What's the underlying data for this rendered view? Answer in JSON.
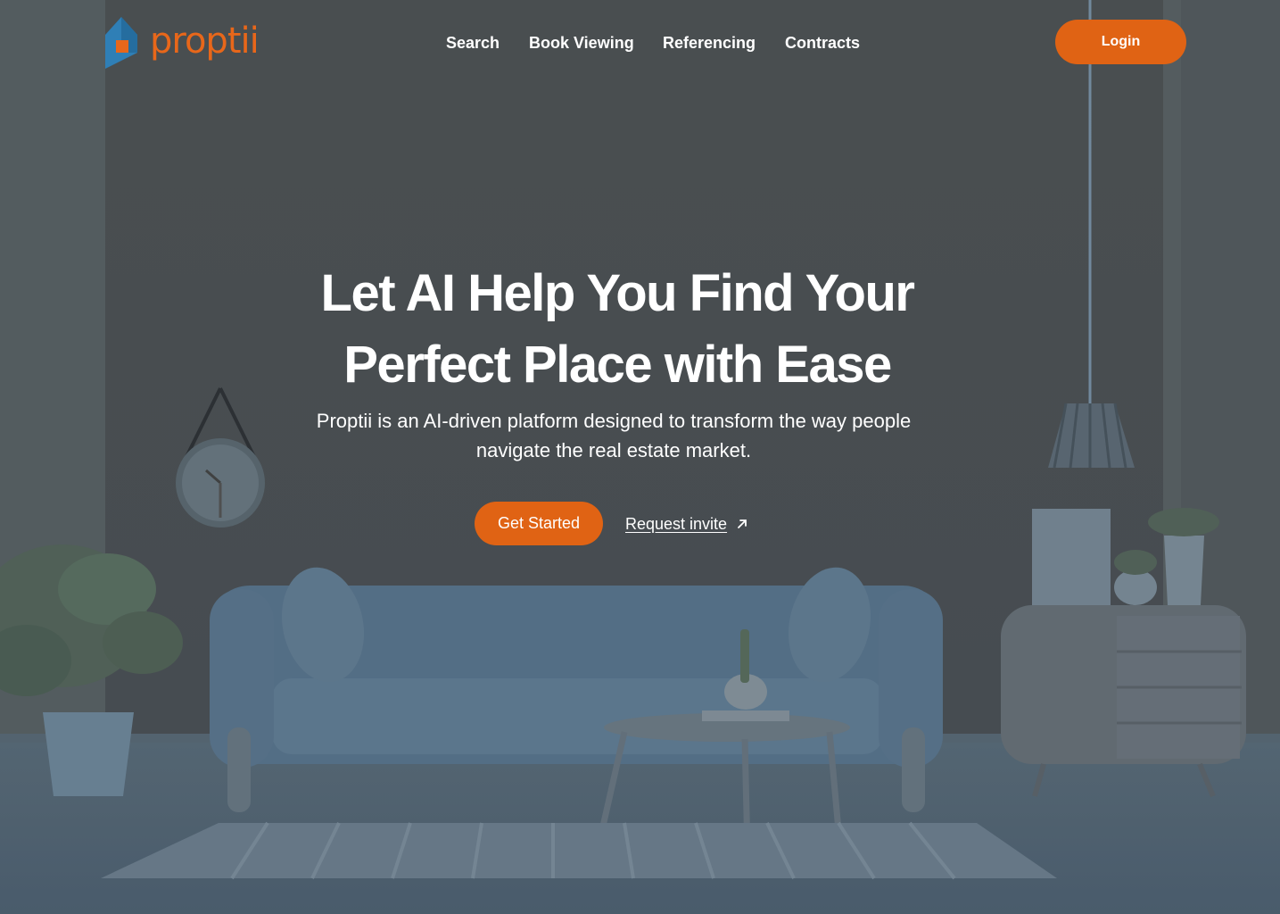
{
  "brand": {
    "name": "proptii",
    "accent": "#e06314",
    "logo_blue": "#2f7fb6"
  },
  "nav": {
    "links": [
      "Search",
      "Book Viewing",
      "Referencing",
      "Contracts"
    ],
    "login_label": "Login"
  },
  "hero": {
    "title_line1": "Let AI Help You Find Your",
    "title_line2": "Perfect Place with Ease",
    "subtitle": "Proptii is an AI-driven platform designed to transform the way people navigate the real estate market.",
    "primary_cta": "Get Started",
    "secondary_cta": "Request invite",
    "secondary_icon": "arrow-up-right-icon"
  },
  "background": {
    "description_icons": [
      "wall-clock",
      "pendant-lamp",
      "sofa",
      "coffee-table",
      "cabinet",
      "potted-plant",
      "rug"
    ]
  }
}
